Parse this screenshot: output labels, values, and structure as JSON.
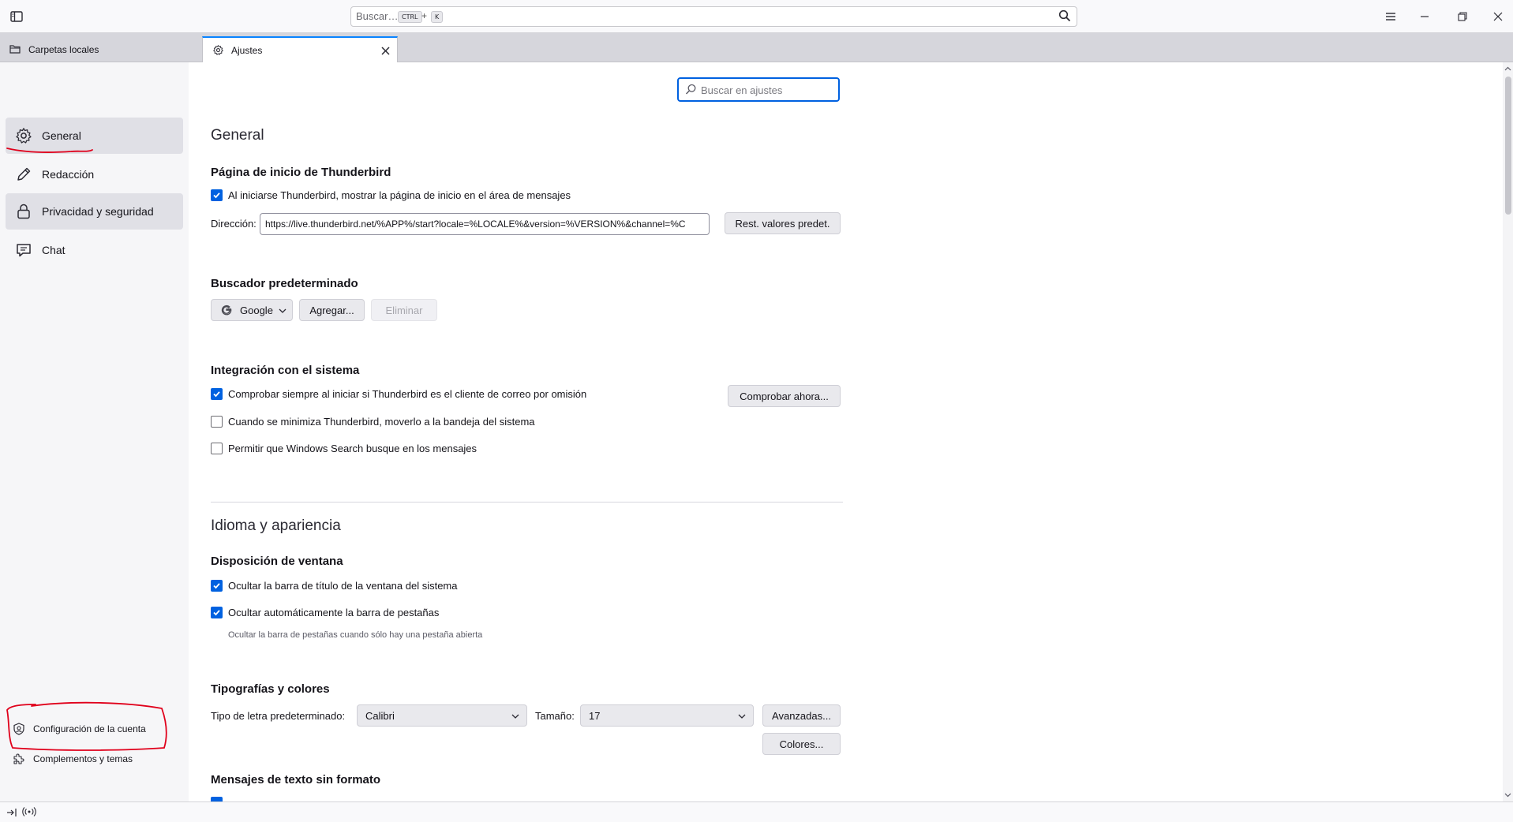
{
  "toolbar": {
    "search_placeholder": "Buscar…",
    "shortcut_ctrl": "CTRL",
    "shortcut_plus": "+",
    "shortcut_key": "K"
  },
  "tabs": [
    {
      "label": "Carpetas locales",
      "icon": "folder-icon"
    },
    {
      "label": "Ajustes",
      "icon": "gear-icon"
    }
  ],
  "sidebar": {
    "items": [
      {
        "label": "General",
        "icon": "gear-icon",
        "selected": true
      },
      {
        "label": "Redacción",
        "icon": "pencil-icon",
        "selected": false
      },
      {
        "label": "Privacidad y seguridad",
        "icon": "lock-icon",
        "selected": true
      },
      {
        "label": "Chat",
        "icon": "chat-icon",
        "selected": false
      }
    ],
    "bottom": [
      {
        "label": "Configuración de la cuenta",
        "icon": "account-settings-icon"
      },
      {
        "label": "Complementos y temas",
        "icon": "puzzle-icon"
      }
    ]
  },
  "settings_search": {
    "placeholder": "Buscar en ajustes"
  },
  "general": {
    "title": "General",
    "start_page": {
      "heading": "Página de inicio de Thunderbird",
      "checkbox": "Al iniciarse Thunderbird, mostrar la página de inicio en el área de mensajes",
      "checked": true,
      "address_label": "Dirección:",
      "address_value": "https://live.thunderbird.net/%APP%/start?locale=%LOCALE%&version=%VERSION%&channel=%C",
      "restore_button": "Rest. valores predet."
    },
    "search_engine": {
      "heading": "Buscador predeterminado",
      "selected": "Google",
      "add_button": "Agregar...",
      "remove_button": "Eliminar"
    },
    "system_integration": {
      "heading": "Integración con el sistema",
      "options": [
        {
          "label": "Comprobar siempre al iniciar si Thunderbird es el cliente de correo por omisión",
          "checked": true
        },
        {
          "label": "Cuando se minimiza Thunderbird, moverlo a la bandeja del sistema",
          "checked": false
        },
        {
          "label": "Permitir que Windows Search busque en los mensajes",
          "checked": false
        }
      ],
      "check_now_button": "Comprobar ahora..."
    }
  },
  "appearance": {
    "title": "Idioma y apariencia",
    "window_layout": {
      "heading": "Disposición de ventana",
      "options": [
        {
          "label": "Ocultar la barra de título de la ventana del sistema",
          "checked": true
        },
        {
          "label": "Ocultar automáticamente la barra de pestañas",
          "checked": true
        }
      ],
      "hint": "Ocultar la barra de pestañas cuando sólo hay una pestaña abierta"
    },
    "fonts": {
      "heading": "Tipografías y colores",
      "font_label": "Tipo de letra predeterminado:",
      "font_value": "Calibri",
      "size_label": "Tamaño:",
      "size_value": "17",
      "advanced_button": "Avanzadas...",
      "colors_button": "Colores..."
    },
    "plain_text": {
      "heading": "Mensajes de texto sin formato"
    }
  },
  "colors": {
    "accent": "#0061e0",
    "annotation": "#e0001b",
    "active_tab_border": "#0a84ff"
  }
}
